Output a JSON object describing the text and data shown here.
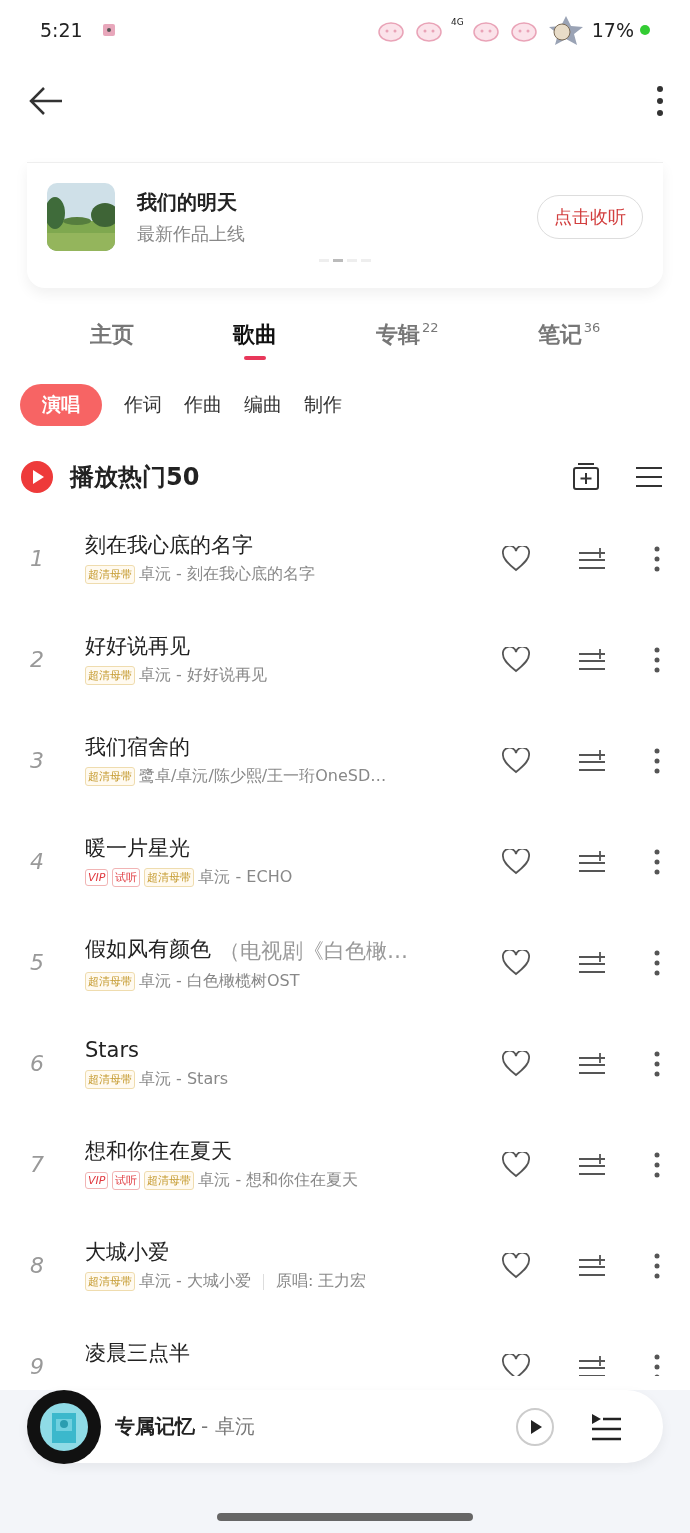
{
  "status_bar": {
    "time": "5:21",
    "network": "4G",
    "battery": "17%"
  },
  "promo": {
    "title": "我们的明天",
    "subtitle": "最新作品上线",
    "button": "点击收听",
    "dots": [
      {
        "selected": false
      },
      {
        "selected": true
      },
      {
        "selected": false
      },
      {
        "selected": false
      }
    ]
  },
  "tabs": [
    {
      "label": "主页",
      "selected": false
    },
    {
      "label": "歌曲",
      "selected": true
    },
    {
      "label": "专辑",
      "count": "22",
      "selected": false
    },
    {
      "label": "笔记",
      "count": "36",
      "selected": false
    }
  ],
  "roles": [
    {
      "label": "演唱",
      "selected": true
    },
    {
      "label": "作词",
      "selected": false
    },
    {
      "label": "作曲",
      "selected": false
    },
    {
      "label": "编曲",
      "selected": false
    },
    {
      "label": "制作",
      "selected": false
    }
  ],
  "list_header": {
    "title": "播放热门50"
  },
  "songs": [
    {
      "rank": "1",
      "title": "刻在我心底的名字",
      "tags": [
        {
          "kind": "master",
          "label": "超清母带"
        }
      ],
      "subtitle": "卓沅 - 刻在我心底的名字"
    },
    {
      "rank": "2",
      "title": "好好说再见",
      "tags": [
        {
          "kind": "master",
          "label": "超清母带"
        }
      ],
      "subtitle": "卓沅 - 好好说再见"
    },
    {
      "rank": "3",
      "title": "我们宿舍的",
      "tags": [
        {
          "kind": "master",
          "label": "超清母带"
        }
      ],
      "subtitle": "鹭卓/卓沅/陈少熙/王一珩OneSD…"
    },
    {
      "rank": "4",
      "title": "暖一片星光",
      "tags": [
        {
          "kind": "vip",
          "label": "VIP"
        },
        {
          "kind": "trial",
          "label": "试听"
        },
        {
          "kind": "master",
          "label": "超清母带"
        }
      ],
      "subtitle": "卓沅 - ECHO"
    },
    {
      "rank": "5",
      "title": "假如风有颜色",
      "title_note": "（电视剧《白色橄…",
      "tags": [
        {
          "kind": "master",
          "label": "超清母带"
        }
      ],
      "subtitle": "卓沅 - 白色橄榄树OST"
    },
    {
      "rank": "6",
      "title": "Stars",
      "tags": [
        {
          "kind": "master",
          "label": "超清母带"
        }
      ],
      "subtitle": "卓沅 - Stars"
    },
    {
      "rank": "7",
      "title": "想和你住在夏天",
      "tags": [
        {
          "kind": "vip",
          "label": "VIP"
        },
        {
          "kind": "trial",
          "label": "试听"
        },
        {
          "kind": "master",
          "label": "超清母带"
        }
      ],
      "subtitle": "卓沅 - 想和你住在夏天"
    },
    {
      "rank": "8",
      "title": "大城小爱",
      "tags": [
        {
          "kind": "master",
          "label": "超清母带"
        }
      ],
      "subtitle": "卓沅 - 大城小爱",
      "original": "原唱: 王力宏"
    },
    {
      "rank": "9",
      "title": "凌晨三点半"
    }
  ],
  "player": {
    "song": "专属记忆",
    "artist": "- 卓沅"
  }
}
